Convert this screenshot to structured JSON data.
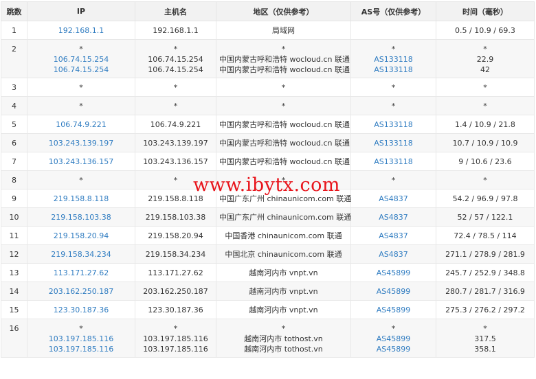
{
  "headers": {
    "hop": "跳数",
    "ip": "IP",
    "host": "主机名",
    "region": "地区（仅供参考）",
    "as": "AS号（仅供参考）",
    "time": "时间（毫秒）"
  },
  "watermark": "www.ibytx.com",
  "rows": [
    {
      "hop": "1",
      "ip": [
        "192.168.1.1"
      ],
      "host": [
        "192.168.1.1"
      ],
      "region": [
        "局域网"
      ],
      "as": [
        ""
      ],
      "time": [
        "0.5 / 10.9 / 69.3"
      ]
    },
    {
      "hop": "2",
      "ip": [
        "*",
        "106.74.15.254",
        "106.74.15.254"
      ],
      "host": [
        "*",
        "106.74.15.254",
        "106.74.15.254"
      ],
      "region": [
        "*",
        "中国内蒙古呼和浩特 wocloud.cn 联通",
        "中国内蒙古呼和浩特 wocloud.cn 联通"
      ],
      "as": [
        "*",
        "AS133118",
        "AS133118"
      ],
      "time": [
        "*",
        "22.9",
        "42"
      ]
    },
    {
      "hop": "3",
      "ip": [
        "*"
      ],
      "host": [
        "*"
      ],
      "region": [
        "*"
      ],
      "as": [
        "*"
      ],
      "time": [
        "*"
      ]
    },
    {
      "hop": "4",
      "ip": [
        "*"
      ],
      "host": [
        "*"
      ],
      "region": [
        "*"
      ],
      "as": [
        "*"
      ],
      "time": [
        "*"
      ]
    },
    {
      "hop": "5",
      "ip": [
        "106.74.9.221"
      ],
      "host": [
        "106.74.9.221"
      ],
      "region": [
        "中国内蒙古呼和浩特 wocloud.cn 联通"
      ],
      "as": [
        "AS133118"
      ],
      "time": [
        "1.4 / 10.9 / 21.8"
      ]
    },
    {
      "hop": "6",
      "ip": [
        "103.243.139.197"
      ],
      "host": [
        "103.243.139.197"
      ],
      "region": [
        "中国内蒙古呼和浩特 wocloud.cn 联通"
      ],
      "as": [
        "AS133118"
      ],
      "time": [
        "10.7 / 10.9 / 10.9"
      ]
    },
    {
      "hop": "7",
      "ip": [
        "103.243.136.157"
      ],
      "host": [
        "103.243.136.157"
      ],
      "region": [
        "中国内蒙古呼和浩特 wocloud.cn 联通"
      ],
      "as": [
        "AS133118"
      ],
      "time": [
        "9 / 10.6 / 23.6"
      ]
    },
    {
      "hop": "8",
      "ip": [
        "*"
      ],
      "host": [
        "*"
      ],
      "region": [
        "*"
      ],
      "as": [
        "*"
      ],
      "time": [
        "*"
      ]
    },
    {
      "hop": "9",
      "ip": [
        "219.158.8.118"
      ],
      "host": [
        "219.158.8.118"
      ],
      "region": [
        "中国广东广州 chinaunicom.com 联通"
      ],
      "as": [
        "AS4837"
      ],
      "time": [
        "54.2 / 96.9 / 97.8"
      ]
    },
    {
      "hop": "10",
      "ip": [
        "219.158.103.38"
      ],
      "host": [
        "219.158.103.38"
      ],
      "region": [
        "中国广东广州 chinaunicom.com 联通"
      ],
      "as": [
        "AS4837"
      ],
      "time": [
        "52 / 57 / 122.1"
      ]
    },
    {
      "hop": "11",
      "ip": [
        "219.158.20.94"
      ],
      "host": [
        "219.158.20.94"
      ],
      "region": [
        "中国香港 chinaunicom.com 联通"
      ],
      "as": [
        "AS4837"
      ],
      "time": [
        "72.4 / 78.5 / 114"
      ]
    },
    {
      "hop": "12",
      "ip": [
        "219.158.34.234"
      ],
      "host": [
        "219.158.34.234"
      ],
      "region": [
        "中国北京 chinaunicom.com 联通"
      ],
      "as": [
        "AS4837"
      ],
      "time": [
        "271.1 / 278.9 / 281.9"
      ]
    },
    {
      "hop": "13",
      "ip": [
        "113.171.27.62"
      ],
      "host": [
        "113.171.27.62"
      ],
      "region": [
        "越南河内市 vnpt.vn"
      ],
      "as": [
        "AS45899"
      ],
      "time": [
        "245.7 / 252.9 / 348.8"
      ]
    },
    {
      "hop": "14",
      "ip": [
        "203.162.250.187"
      ],
      "host": [
        "203.162.250.187"
      ],
      "region": [
        "越南河内市 vnpt.vn"
      ],
      "as": [
        "AS45899"
      ],
      "time": [
        "280.7 / 281.7 / 316.9"
      ]
    },
    {
      "hop": "15",
      "ip": [
        "123.30.187.36"
      ],
      "host": [
        "123.30.187.36"
      ],
      "region": [
        "越南河内市 vnpt.vn"
      ],
      "as": [
        "AS45899"
      ],
      "time": [
        "275.3 / 276.2 / 297.2"
      ]
    },
    {
      "hop": "16",
      "ip": [
        "*",
        "103.197.185.116",
        "103.197.185.116"
      ],
      "host": [
        "*",
        "103.197.185.116",
        "103.197.185.116"
      ],
      "region": [
        "*",
        "越南河内市 tothost.vn",
        "越南河内市 tothost.vn"
      ],
      "as": [
        "*",
        "AS45899",
        "AS45899"
      ],
      "time": [
        "*",
        "317.5",
        "358.1"
      ]
    }
  ]
}
